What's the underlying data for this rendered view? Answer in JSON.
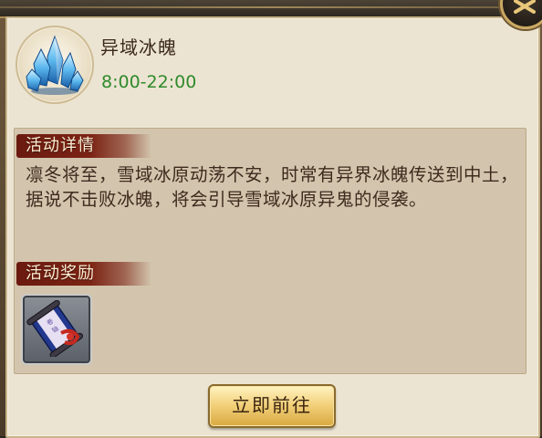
{
  "activity": {
    "name": "异域冰魄",
    "time": "8:00-22:00",
    "icon": "ice-crystal-icon"
  },
  "details": {
    "heading": "活动详情",
    "description": "凛冬将至，雪域冰原动荡不安，时常有异界冰魄传送到中土，据说不击败冰魄，将会引导雪域冰原异鬼的侵袭。"
  },
  "rewards": {
    "heading": "活动奖励",
    "items": [
      {
        "icon": "scroll-icon"
      }
    ]
  },
  "actions": {
    "go_label": "立即前往"
  },
  "colors": {
    "time_green": "#2f8a2b",
    "ribbon_red": "#7c2415",
    "panel_bg": "#ece4d2",
    "content_bg": "#d3c5ad",
    "button_gold": "#f3d27d"
  }
}
